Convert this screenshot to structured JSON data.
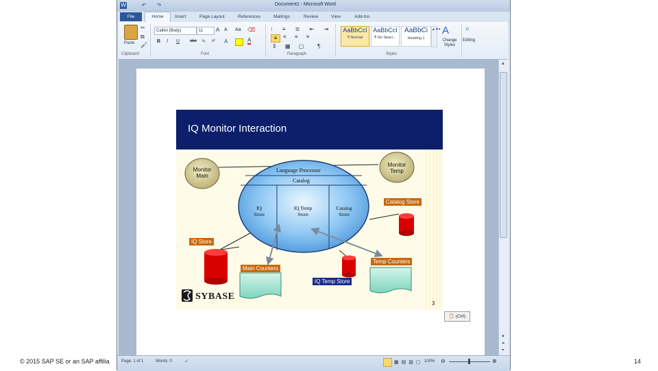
{
  "window": {
    "title": "Document1 - Microsoft Word",
    "quick_access": [
      "W",
      "↶",
      "↷"
    ]
  },
  "tabs": [
    "File",
    "Home",
    "Insert",
    "Page Layout",
    "References",
    "Mailings",
    "Review",
    "View",
    "Add-Ins"
  ],
  "ribbon": {
    "paste_label": "Paste",
    "clipboard_label": "Clipboard",
    "font_name": "Calibri (Body)",
    "font_size": "11",
    "font_label": "Font",
    "paragraph_label": "Paragraph",
    "styles_label": "Styles",
    "editing_label": "Editing",
    "change_styles_label": "Change Styles",
    "styles": [
      {
        "sample": "AaBbCcI",
        "name": "¶ Normal"
      },
      {
        "sample": "AaBbCcI",
        "name": "¶ No Spaci..."
      },
      {
        "sample": "AaBbCi",
        "name": "Heading 1"
      }
    ],
    "format_buttons": [
      "B",
      "I",
      "U",
      "abe",
      "x₂",
      "x²"
    ]
  },
  "status": {
    "page": "Page: 1 of 1",
    "words": "Words: 0",
    "zoom": "100%"
  },
  "slide": {
    "title": "IQ Monitor Interaction",
    "monitor_main": [
      "Monitor",
      "Main"
    ],
    "monitor_temp": [
      "Monitor",
      "Temp"
    ],
    "language_processor": "Language Processor",
    "catalog": "Catalog",
    "iq_store_inner": [
      "IQ",
      "Store"
    ],
    "iq_temp_store_inner": [
      "IQ Temp",
      "Store"
    ],
    "catalog_store_inner": [
      "Catalog",
      "Store"
    ],
    "catalog_store_label": "Catalog Store",
    "iq_store_label": "IQ Store",
    "main_counters": "Main Counters",
    "temp_counters": "Temp Counters",
    "iq_temp_store_label": "IQ Temp Store",
    "logo": "SYBASE",
    "page_number": "3"
  },
  "paste_options": "(Ctrl)",
  "footer": {
    "copyright": "© 2015 SAP SE or an SAP affilia",
    "page_number": "14"
  }
}
